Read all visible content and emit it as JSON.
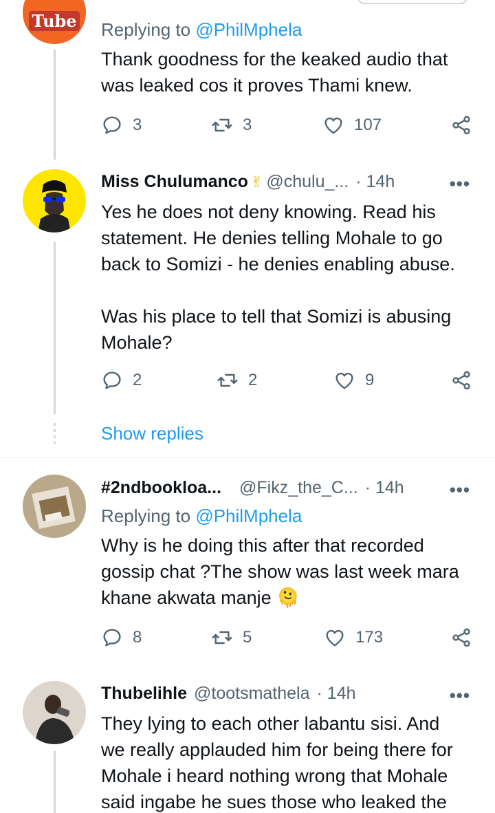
{
  "tweets": [
    {
      "avatar_label": "Tube",
      "replying_prefix": "Replying to",
      "replying_mention": "@PhilMphela",
      "text": "Thank goodness for the keaked audio that\nwas leaked cos it proves Thami knew.",
      "replies": "3",
      "retweets": "3",
      "likes": "107"
    },
    {
      "name": "Miss Chulumanco",
      "badge": "✌",
      "handle": "@chulu_...",
      "time": "· 14h",
      "text": "Yes he does not deny knowing. Read his\nstatement. He denies telling Mohale to go\nback to Somizi - he denies enabling abuse.\n\nWas his place to tell that Somizi is abusing\nMohale?",
      "replies": "2",
      "retweets": "2",
      "likes": "9",
      "show_replies": "Show replies"
    },
    {
      "name": "#2ndbookloa...",
      "handle": "@Fikz_the_C...",
      "time": "· 14h",
      "replying_prefix": "Replying to",
      "replying_mention": "@PhilMphela",
      "text": "Why is he doing this after that recorded\ngossip chat ?The show was last week mara\nkhane akwata manje 🫠",
      "replies": "8",
      "retweets": "5",
      "likes": "173"
    },
    {
      "name": "Thubelihle",
      "handle": "@tootsmathela",
      "time": "· 14h",
      "text": "They lying to each other labantu sisi. And\nwe really applauded him for being there for\nMohale i heard nothing wrong that Mohale\nsaid ingabe he sues those who leaked the"
    }
  ],
  "more_glyph": "•••",
  "colors": {
    "accent": "#1d9bf0",
    "muted": "#536471",
    "text": "#0f1419",
    "line": "#cfd9de"
  }
}
